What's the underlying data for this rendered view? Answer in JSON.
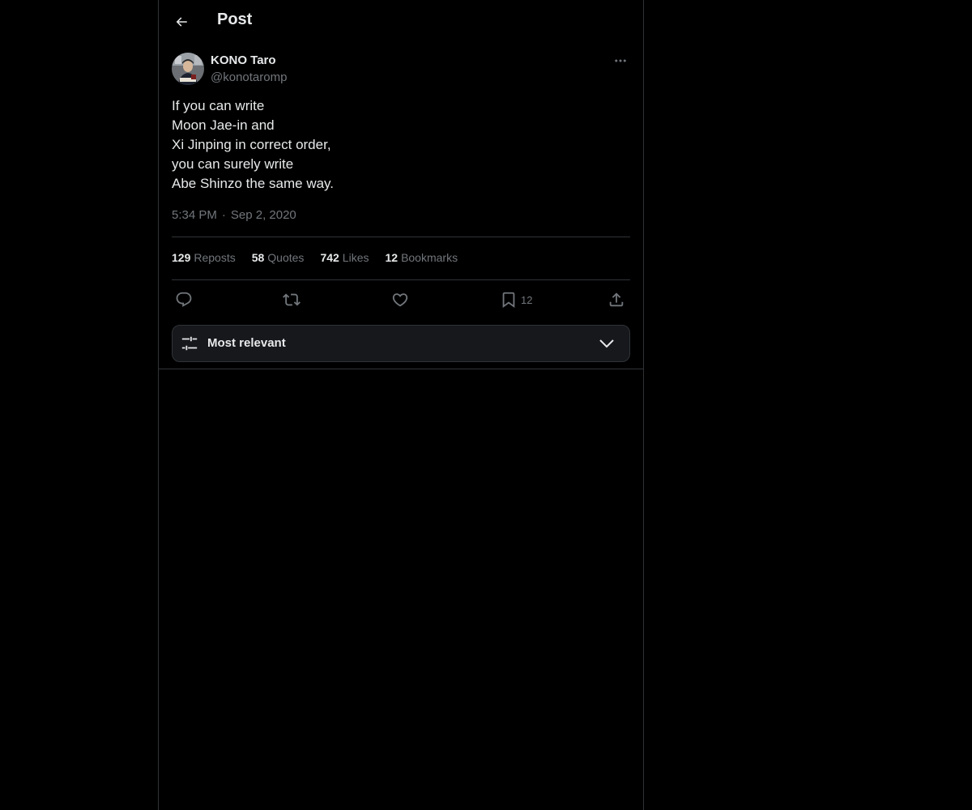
{
  "header": {
    "title": "Post"
  },
  "author": {
    "name": "KONO Taro",
    "handle": "@konotaromp"
  },
  "post": {
    "lines": [
      "If you can write",
      "Moon Jae-in and",
      "Xi Jinping in correct order,",
      "you can surely write",
      "Abe Shinzo the same way."
    ],
    "time": "5:34 PM",
    "separator": "·",
    "date": "Sep 2, 2020"
  },
  "stats": {
    "reposts_count": "129",
    "reposts_label": "Reposts",
    "quotes_count": "58",
    "quotes_label": "Quotes",
    "likes_count": "742",
    "likes_label": "Likes",
    "bookmarks_count": "12",
    "bookmarks_label": "Bookmarks"
  },
  "actions": {
    "bookmark_count": "12",
    "icons": [
      "reply-icon",
      "repost-icon",
      "like-icon",
      "bookmark-icon",
      "share-icon"
    ]
  },
  "sort": {
    "label": "Most relevant"
  },
  "colors": {
    "background": "#000000",
    "text": "#e7e9ea",
    "secondary_text": "#71767b",
    "border": "#2f3336",
    "sort_box": "#16181c"
  }
}
